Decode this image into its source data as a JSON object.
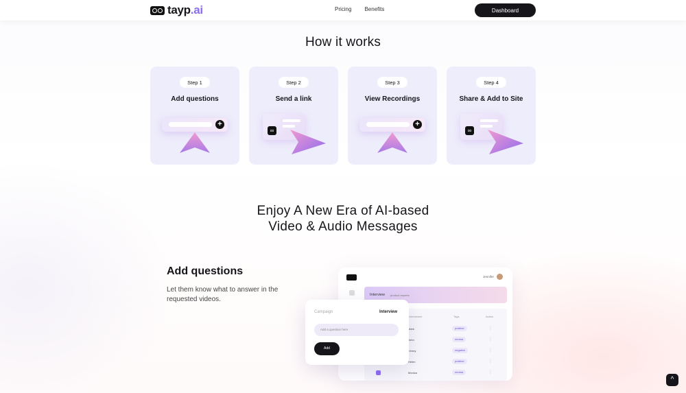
{
  "nav": {
    "logo_main": "tayp",
    "logo_suffix": ".ai",
    "links": [
      "Pricing",
      "Benefits"
    ],
    "dashboard_label": "Dashboard"
  },
  "how": {
    "title": "How it works",
    "steps": [
      {
        "pill": "Step 1",
        "title": "Add questions"
      },
      {
        "pill": "Step 2",
        "title": "Send a link"
      },
      {
        "pill": "Step 3",
        "title": "View Recordings"
      },
      {
        "pill": "Step 4",
        "title": "Share & Add to Site"
      }
    ]
  },
  "enjoy": {
    "line1": "Enjoy A New Era of AI-based",
    "line2": "Video & Audio Messages"
  },
  "feature": {
    "title": "Add questions",
    "description": "Let them know what to answer in the requested videos."
  },
  "mockup": {
    "user_name": "Jennifer",
    "banner_title": "Interview",
    "banner_sub": "product experts",
    "col_name": "Interviewee",
    "col_tag": "Tags",
    "col_action": "Action",
    "rows": [
      {
        "name": "Mark",
        "tag": "positive"
      },
      {
        "name": "John",
        "tag": "neutral"
      },
      {
        "name": "Kenny",
        "tag": "negative"
      },
      {
        "name": "Helen",
        "tag": "positive"
      },
      {
        "name": "Monica",
        "tag": "neutral"
      }
    ],
    "tab_campaign": "Campaign",
    "tab_interview": "Interview",
    "input_placeholder": "Add a question here",
    "add_label": "Add"
  },
  "icons": {
    "plus": "+",
    "link": "🔗",
    "scroll_top": "^",
    "dots": "⋮"
  },
  "colors": {
    "accent": "#8a6cf5",
    "dark": "#15151a",
    "card_bg": "#eeedfb"
  }
}
